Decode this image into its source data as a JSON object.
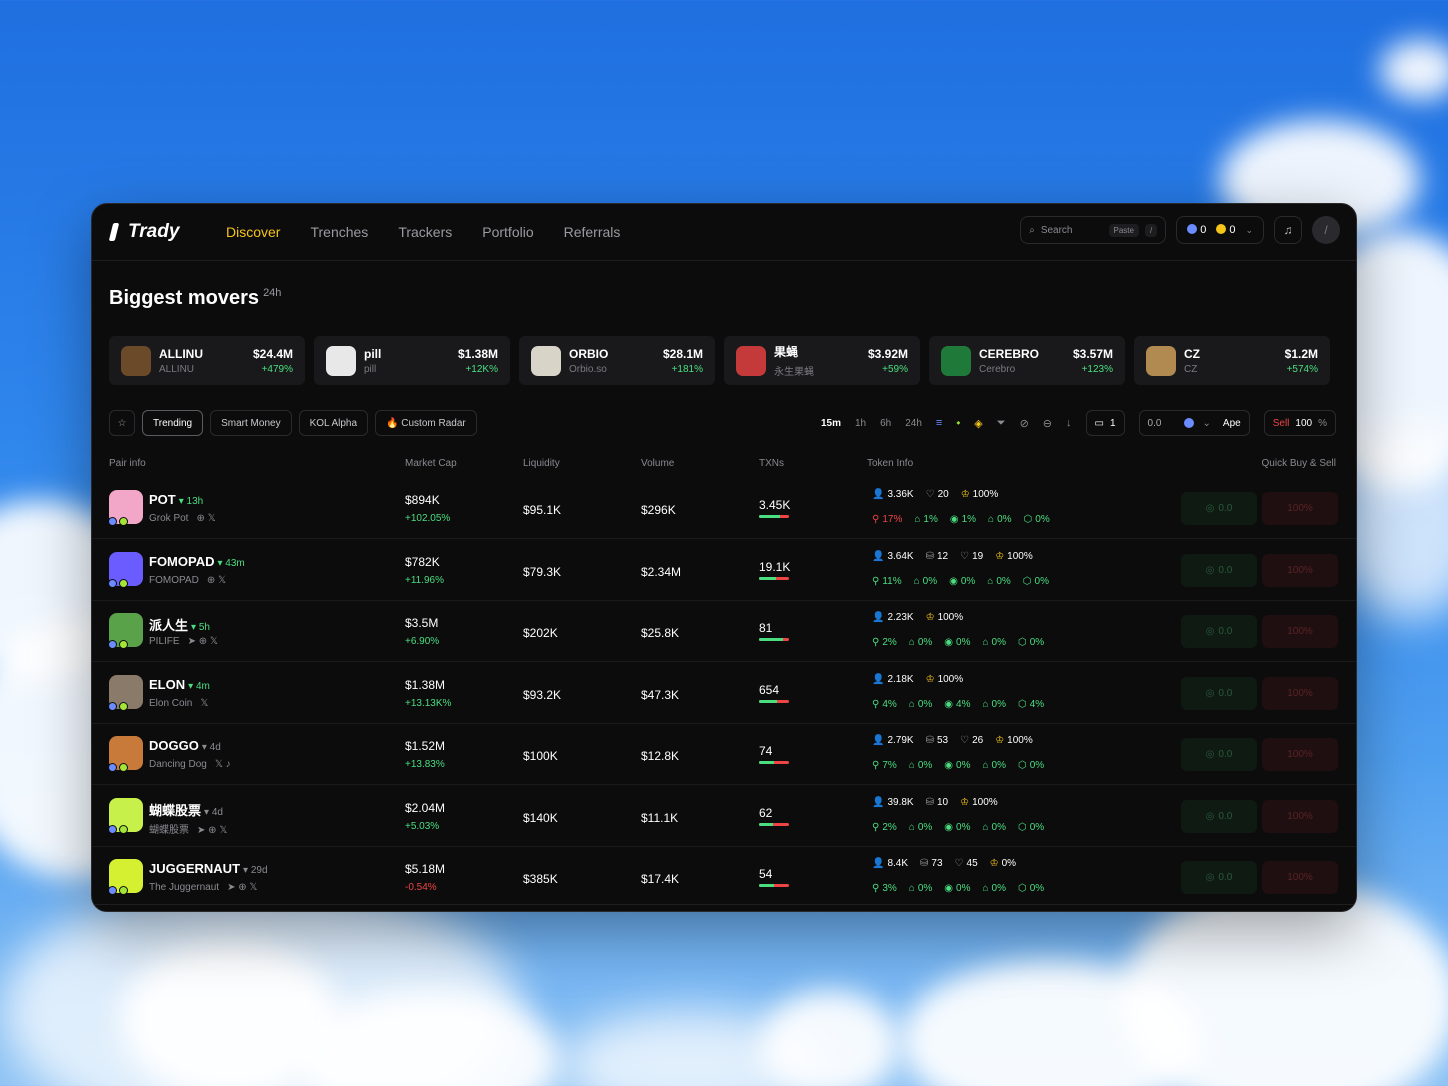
{
  "app": {
    "name": "Trady"
  },
  "nav": [
    "Discover",
    "Trenches",
    "Trackers",
    "Portfolio",
    "Referrals"
  ],
  "search": {
    "placeholder": "Search",
    "paste": "Paste",
    "shortcut": "/"
  },
  "wallet": {
    "sol": "0",
    "bnb": "0"
  },
  "section": {
    "title": "Biggest movers",
    "period": "24h"
  },
  "movers": [
    {
      "name": "ALLINU",
      "sub": "ALLINU",
      "price": "$24.4M",
      "change": "+479%",
      "color": "#6b4a2a"
    },
    {
      "name": "pill",
      "sub": "pill",
      "price": "$1.38M",
      "change": "+12K%",
      "color": "#e8e8e8"
    },
    {
      "name": "ORBIO",
      "sub": "Orbio.so",
      "price": "$28.1M",
      "change": "+181%",
      "color": "#d8d4c8"
    },
    {
      "name": "果蝇",
      "sub": "永生果蝇",
      "price": "$3.92M",
      "change": "+59%",
      "color": "#c43a3a"
    },
    {
      "name": "CEREBRO",
      "sub": "Cerebro",
      "price": "$3.57M",
      "change": "+123%",
      "color": "#1f7a3a"
    },
    {
      "name": "CZ",
      "sub": "CZ",
      "price": "$1.2M",
      "change": "+574%",
      "color": "#b08a50"
    }
  ],
  "filters": {
    "tabs": [
      "Trending",
      "Smart Money",
      "KOL Alpha",
      "🔥 Custom Radar"
    ],
    "ranges": [
      "15m",
      "1h",
      "6h",
      "24h"
    ],
    "count": "1",
    "amount": "0.0",
    "ape": "Ape",
    "sell_label": "Sell",
    "sell_value": "100",
    "sell_unit": "%"
  },
  "columns": {
    "pair": "Pair info",
    "mcap": "Market Cap",
    "liq": "Liquidity",
    "vol": "Volume",
    "txns": "TXNs",
    "info": "Token Info",
    "quick": "Quick Buy & Sell"
  },
  "rows": [
    {
      "name": "POT",
      "age": "13h",
      "sub": "Grok Pot",
      "mcap": "$894K",
      "chg": "+102.05%",
      "liq": "$95.1K",
      "vol": "$296K",
      "tx": "3.45K",
      "buy": 0.7,
      "holders": "3.36K",
      "snipers": "",
      "pro": "20",
      "top": "100%",
      "m": [
        "17%",
        "1%",
        "1%",
        "0%",
        "0%"
      ],
      "color": "#f2a6c8",
      "sub_icons": "⊕  𝕏"
    },
    {
      "name": "FOMOPAD",
      "age": "43m",
      "sub": "FOMOPAD",
      "mcap": "$782K",
      "chg": "+11.96%",
      "liq": "$79.3K",
      "vol": "$2.34M",
      "tx": "19.1K",
      "buy": 0.55,
      "holders": "3.64K",
      "snipers": "12",
      "pro": "19",
      "top": "100%",
      "m": [
        "11%",
        "0%",
        "0%",
        "0%",
        "0%"
      ],
      "color": "#6a5cff",
      "sub_icons": "⊕  𝕏"
    },
    {
      "name": "派人生",
      "age": "5h",
      "sub": "PILIFE",
      "mcap": "$3.5M",
      "chg": "+6.90%",
      "liq": "$202K",
      "vol": "$25.8K",
      "tx": "81",
      "buy": 0.8,
      "holders": "2.23K",
      "snipers": "",
      "pro": "",
      "top": "100%",
      "m": [
        "2%",
        "0%",
        "0%",
        "0%",
        "0%"
      ],
      "color": "#5aa24a",
      "sub_icons": "➤  ⊕  𝕏"
    },
    {
      "name": "ELON",
      "age": "4m",
      "sub": "Elon Coin",
      "mcap": "$1.38M",
      "chg": "+13.13K%",
      "liq": "$93.2K",
      "vol": "$47.3K",
      "tx": "654",
      "buy": 0.6,
      "holders": "2.18K",
      "snipers": "",
      "pro": "",
      "top": "100%",
      "m": [
        "4%",
        "0%",
        "4%",
        "0%",
        "4%"
      ],
      "color": "#8a7a6a",
      "sub_icons": "𝕏"
    },
    {
      "name": "DOGGO",
      "age": "4d",
      "sub": "Dancing Dog",
      "mcap": "$1.52M",
      "chg": "+13.83%",
      "liq": "$100K",
      "vol": "$12.8K",
      "tx": "74",
      "buy": 0.5,
      "holders": "2.79K",
      "snipers": "53",
      "pro": "26",
      "top": "100%",
      "m": [
        "7%",
        "0%",
        "0%",
        "0%",
        "0%"
      ],
      "color": "#c87a3a",
      "sub_icons": "𝕏  ♪"
    },
    {
      "name": "蝴蝶股票",
      "age": "4d",
      "sub": "蝴蝶股票",
      "mcap": "$2.04M",
      "chg": "+5.03%",
      "liq": "$140K",
      "vol": "$11.1K",
      "tx": "62",
      "buy": 0.45,
      "holders": "39.8K",
      "snipers": "10",
      "pro": "",
      "top": "100%",
      "m": [
        "2%",
        "0%",
        "0%",
        "0%",
        "0%"
      ],
      "color": "#c8f04a",
      "sub_icons": "➤  ⊕  𝕏"
    },
    {
      "name": "JUGGERNAUT",
      "age": "29d",
      "sub": "The Juggernaut",
      "mcap": "$5.18M",
      "chg": "-0.54%",
      "liq": "$385K",
      "vol": "$17.4K",
      "tx": "54",
      "buy": 0.5,
      "holders": "8.4K",
      "snipers": "73",
      "pro": "45",
      "top": "0%",
      "m": [
        "3%",
        "0%",
        "0%",
        "0%",
        "0%"
      ],
      "color": "#d4f030",
      "sub_icons": "➤  ⊕  𝕏"
    }
  ],
  "quick": {
    "buy": "0.0",
    "sell": "100%"
  }
}
